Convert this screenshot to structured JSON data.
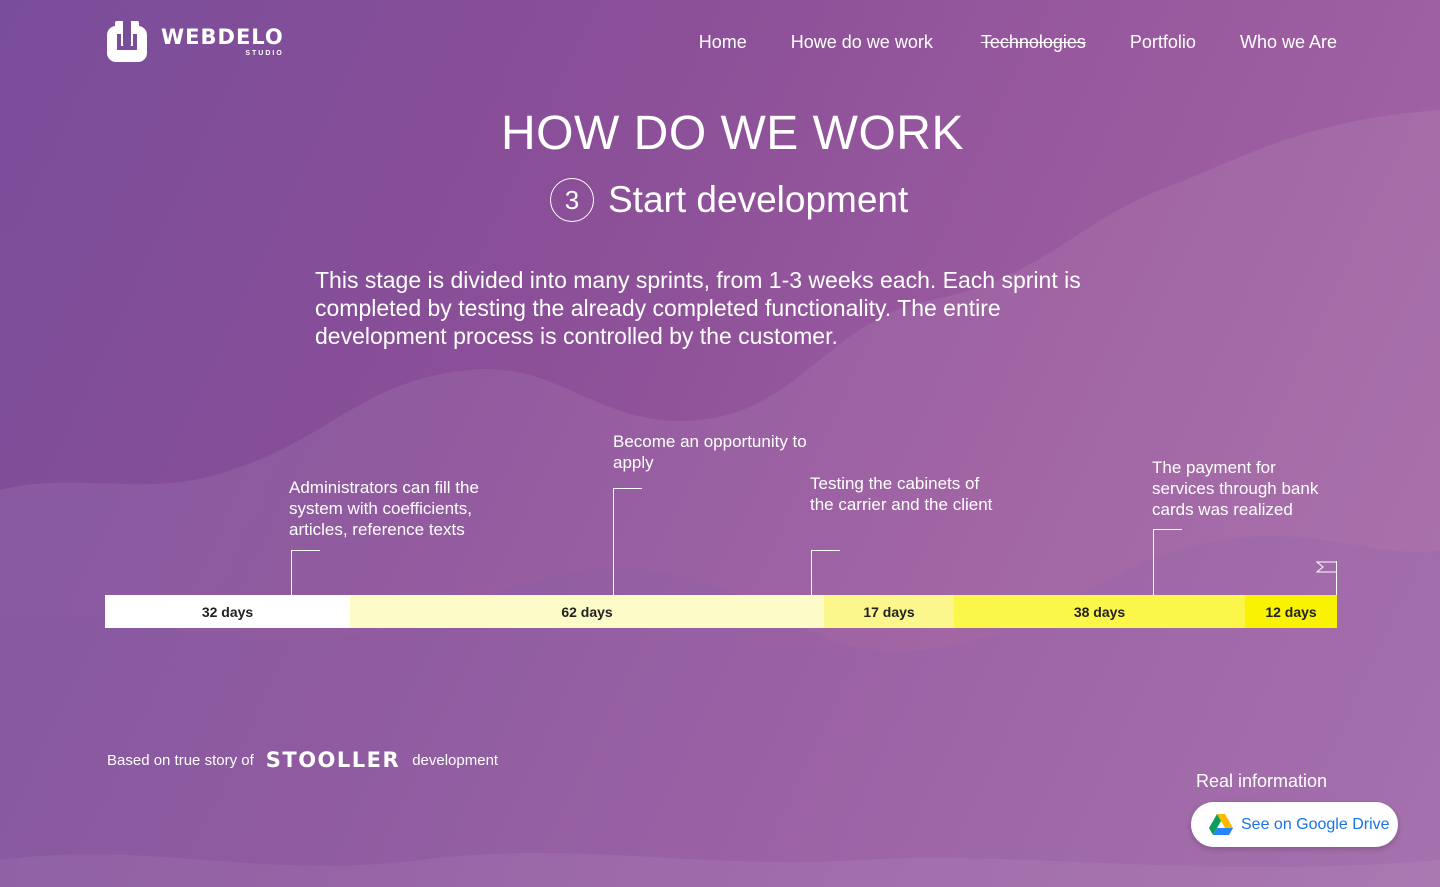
{
  "brand": {
    "name": "WEBDELO",
    "sub": "STUDIO"
  },
  "nav": [
    {
      "label": "Home"
    },
    {
      "label": "Howe do we work"
    },
    {
      "label": "Technologies"
    },
    {
      "label": "Portfolio"
    },
    {
      "label": "Who we Are"
    }
  ],
  "title": "HOW DO WE WORK",
  "step": {
    "number": "3",
    "title": "Start development"
  },
  "description": "This stage is divided into many sprints, from 1-3 weeks each. Each sprint is completed by testing the already completed functionality. The entire development process is controlled by the customer.",
  "timeline": {
    "segments": [
      {
        "label": "32 days",
        "days": 32,
        "color": "#ffffff"
      },
      {
        "label": "62 days",
        "days": 62,
        "color": "#fdfbc8"
      },
      {
        "label": "17 days",
        "days": 17,
        "color": "#fbf78d"
      },
      {
        "label": "38 days",
        "days": 38,
        "color": "#fbf64a"
      },
      {
        "label": "12 days",
        "days": 12,
        "color": "#f9f200"
      }
    ],
    "milestones": [
      {
        "text": "Administrators can fill the system with coefficients, articles, reference texts"
      },
      {
        "text": "Become an opportunity to apply"
      },
      {
        "text": "Testing the cabinets of the carrier and the client"
      },
      {
        "text": "The payment for services through bank cards was realized"
      }
    ]
  },
  "footer": {
    "prefix": "Based on true story of",
    "project": "STOOLLER",
    "suffix": "development",
    "real_info": "Real information",
    "drive_button": "See on Google Drive"
  }
}
